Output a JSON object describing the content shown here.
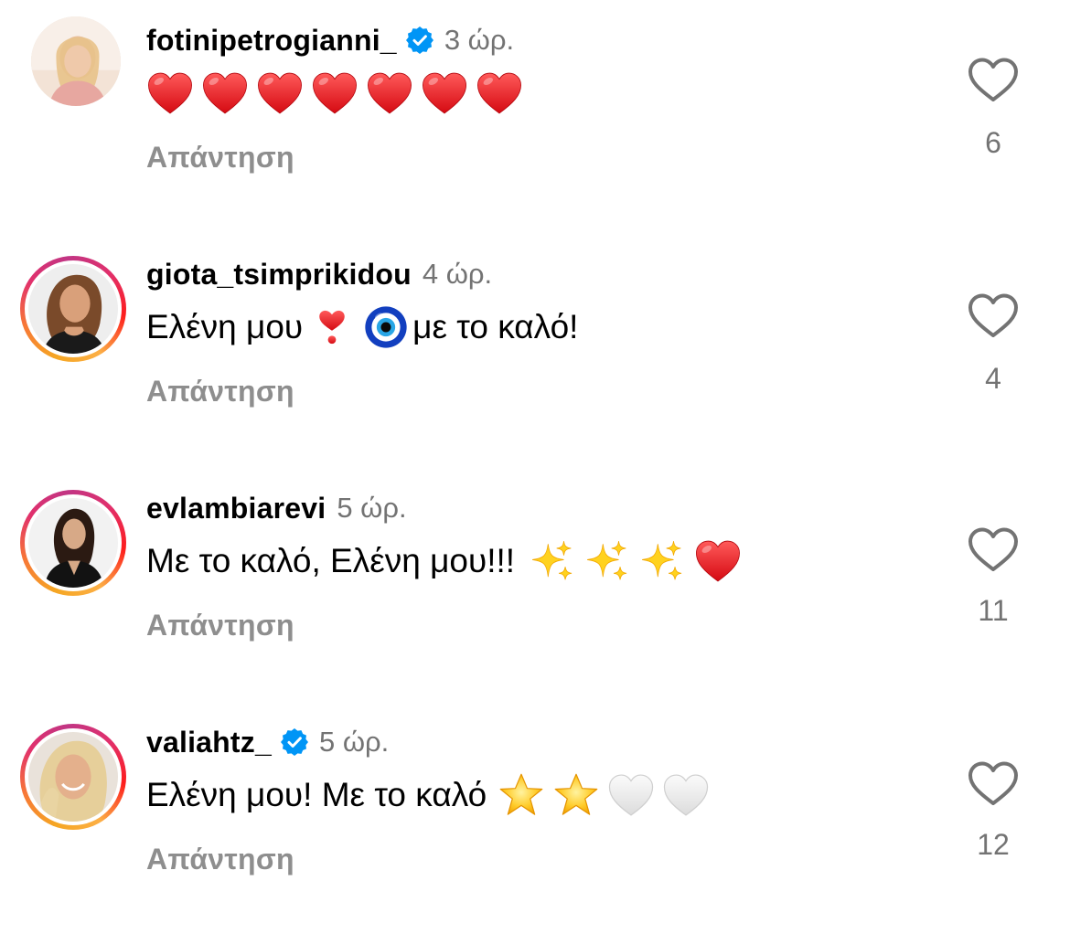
{
  "comments": [
    {
      "username": "fotinipetrogianni_",
      "verified": true,
      "time": "3 ώρ.",
      "text": "",
      "emojis": [
        "red-heart",
        "red-heart",
        "red-heart",
        "red-heart",
        "red-heart",
        "red-heart",
        "red-heart"
      ],
      "reply_label": "Απάντηση",
      "likes": "6"
    },
    {
      "username": "giota_tsimprikidou",
      "verified": false,
      "time": "4 ώρ.",
      "text_before": "Ελένη μου",
      "emojis": [
        "heavy-exclamation-heart",
        "nazar-amulet"
      ],
      "text_after": "με το καλό!",
      "reply_label": "Απάντηση",
      "likes": "4"
    },
    {
      "username": "evlambiarevi",
      "verified": false,
      "time": "5 ώρ.",
      "text": "Με το καλό, Ελένη μου!!!",
      "emojis": [
        "sparkles",
        "sparkles",
        "sparkles",
        "red-heart"
      ],
      "reply_label": "Απάντηση",
      "likes": "11"
    },
    {
      "username": "valiahtz_",
      "verified": true,
      "time": "5 ώρ.",
      "text": "Ελένη μου! Με το καλό",
      "emojis": [
        "star",
        "star",
        "white-heart",
        "white-heart"
      ],
      "reply_label": "Απάντηση",
      "likes": "12"
    }
  ],
  "colors": {
    "verified_blue": "#0095f6",
    "secondary_text": "#737373",
    "reply_text": "#8e8e8e",
    "heart_red": "#f0151f"
  }
}
